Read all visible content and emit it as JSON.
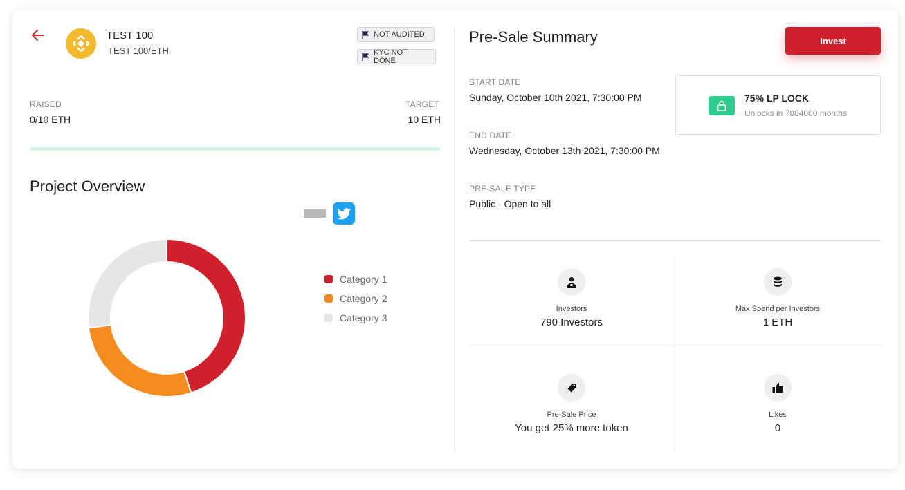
{
  "token": {
    "name": "TEST 100",
    "pair": "TEST 100/ETH",
    "logo_icon": "binance-logo-icon",
    "logo_color": "#f3ba2f"
  },
  "badges": {
    "audit": "NOT AUDITED",
    "kyc": "KYC NOT DONE"
  },
  "raise": {
    "raised_label": "RAISED",
    "raised_value": "0/10 ETH",
    "target_label": "TARGET",
    "target_value": "10 ETH",
    "progress_fraction": 0
  },
  "overview": {
    "title": "Project Overview",
    "social": [
      "link-icon",
      "twitter-icon"
    ]
  },
  "chart_data": {
    "type": "pie",
    "categories": [
      "Category 1",
      "Category 2",
      "Category 3"
    ],
    "values": [
      45,
      28,
      27
    ],
    "colors": [
      "#d0202b",
      "#f68b1f",
      "#e6e6e6"
    ],
    "legend_position": "right"
  },
  "summary": {
    "title": "Pre-Sale Summary",
    "invest_label": "Invest",
    "start_label": "START DATE",
    "start_value": "Sunday, October 10th 2021, 7:30:00 PM",
    "end_label": "END DATE",
    "end_value": "Wednesday, October 13th 2021, 7:30:00 PM",
    "type_label": "PRE-SALE TYPE",
    "type_value": "Public - Open to all"
  },
  "lock": {
    "title": "75% LP LOCK",
    "subtitle": "Unlocks in 7884000 months"
  },
  "stats": [
    {
      "icon": "investor-icon",
      "label": "Investors",
      "value": "790 Investors"
    },
    {
      "icon": "coins-icon",
      "label": "Max Spend per Investors",
      "value": "1 ETH"
    },
    {
      "icon": "tag-icon",
      "label": "Pre-Sale Price",
      "value": "You get 25% more token"
    },
    {
      "icon": "thumbs-up-icon",
      "label": "Likes",
      "value": "0"
    }
  ],
  "colors": {
    "accent": "#d0202b",
    "lock_green": "#2ecc8f",
    "twitter": "#1da1f2"
  }
}
